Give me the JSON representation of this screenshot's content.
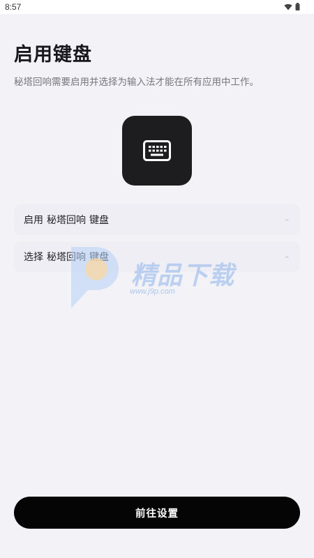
{
  "status_bar": {
    "time": "8:57",
    "icons": [
      "wifi-icon",
      "battery-icon"
    ]
  },
  "header": {
    "title": "启用键盘",
    "subtitle": "秘塔回响需要启用并选择为输入法才能在所有应用中工作。"
  },
  "hero": {
    "icon": "keyboard-icon",
    "tile_color": "#1d1d1f"
  },
  "steps": [
    {
      "verb": "启用",
      "app": "秘塔回响",
      "object": "键盘",
      "status": "–"
    },
    {
      "verb": "选择",
      "app": "秘塔回响",
      "object": "键盘",
      "status": "–"
    }
  ],
  "watermark": {
    "text": "精品下载",
    "url": "www.j9p.com"
  },
  "footer": {
    "button_label": "前往设置",
    "button_color": "#050505"
  },
  "colors": {
    "background": "#f3f2f7",
    "accent": "#050505"
  }
}
